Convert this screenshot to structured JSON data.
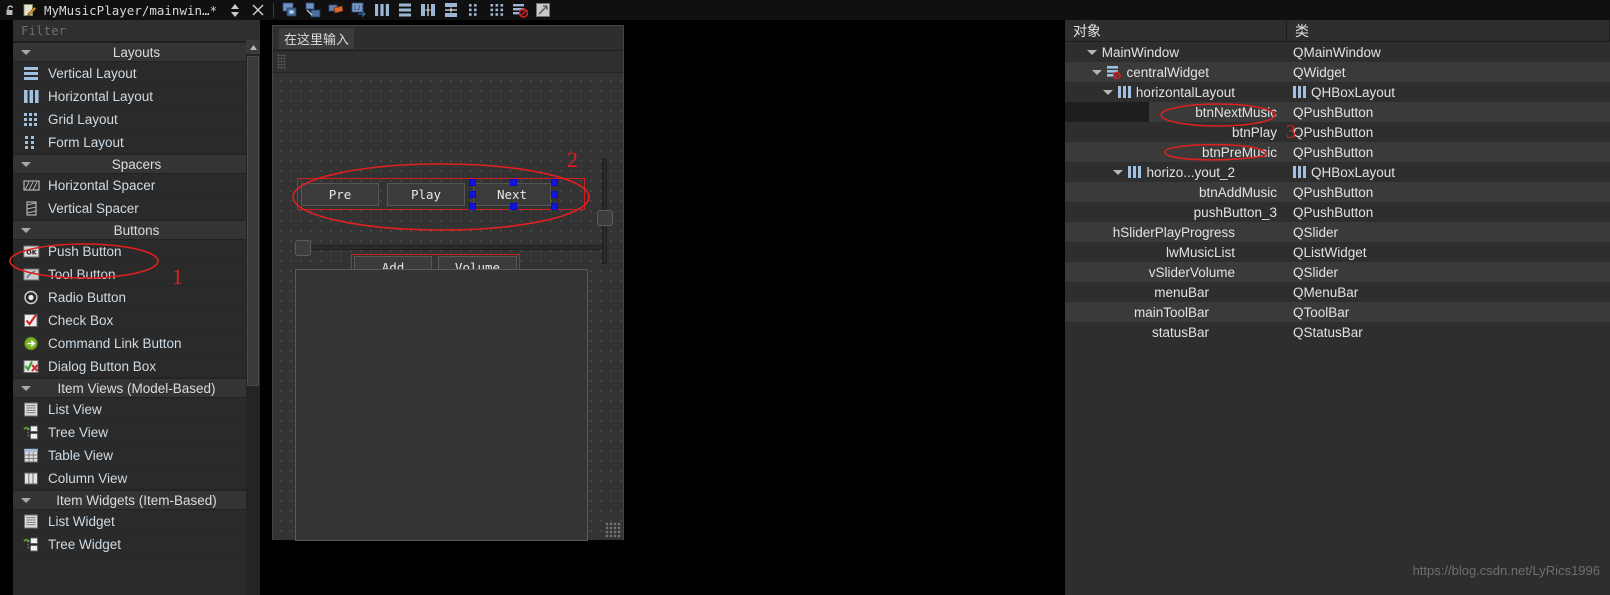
{
  "titlebar": {
    "title": "MyMusicPlayer/mainwin…*",
    "icons": [
      {
        "name": "lock-open-icon"
      },
      {
        "name": "edit-pencil-icon"
      }
    ],
    "buttons": [
      {
        "name": "spin-updown-button"
      },
      {
        "name": "close-button"
      },
      {
        "name": "edit-widgets-button"
      },
      {
        "name": "edit-signals-slots-button"
      },
      {
        "name": "edit-buddies-button"
      },
      {
        "name": "edit-tab-order-button"
      },
      {
        "name": "layout-horizontally-button"
      },
      {
        "name": "layout-vertically-button"
      },
      {
        "name": "layout-splitter-horizontal-button"
      },
      {
        "name": "layout-splitter-vertical-button"
      },
      {
        "name": "layout-form-button"
      },
      {
        "name": "layout-grid-button"
      },
      {
        "name": "break-layout-button"
      },
      {
        "name": "adjust-size-button"
      }
    ]
  },
  "widgetbox": {
    "filter_placeholder": "Filter",
    "groups": [
      {
        "label": "Layouts",
        "items": [
          {
            "label": "Vertical Layout",
            "icon": "vertical-layout-icon"
          },
          {
            "label": "Horizontal Layout",
            "icon": "horizontal-layout-icon"
          },
          {
            "label": "Grid Layout",
            "icon": "grid-layout-icon"
          },
          {
            "label": "Form Layout",
            "icon": "form-layout-icon"
          }
        ]
      },
      {
        "label": "Spacers",
        "items": [
          {
            "label": "Horizontal Spacer",
            "icon": "horizontal-spacer-icon"
          },
          {
            "label": "Vertical Spacer",
            "icon": "vertical-spacer-icon"
          }
        ]
      },
      {
        "label": "Buttons",
        "items": [
          {
            "label": "Push Button",
            "icon": "push-button-icon"
          },
          {
            "label": "Tool Button",
            "icon": "tool-button-icon"
          },
          {
            "label": "Radio Button",
            "icon": "radio-button-icon"
          },
          {
            "label": "Check Box",
            "icon": "check-box-icon"
          },
          {
            "label": "Command Link Button",
            "icon": "command-link-button-icon"
          },
          {
            "label": "Dialog Button Box",
            "icon": "dialog-button-box-icon"
          }
        ]
      },
      {
        "label": "Item Views (Model-Based)",
        "items": [
          {
            "label": "List View",
            "icon": "list-view-icon"
          },
          {
            "label": "Tree View",
            "icon": "tree-view-icon"
          },
          {
            "label": "Table View",
            "icon": "table-view-icon"
          },
          {
            "label": "Column View",
            "icon": "column-view-icon"
          }
        ]
      },
      {
        "label": "Item Widgets (Item-Based)",
        "items": [
          {
            "label": "List Widget",
            "icon": "list-widget-icon"
          },
          {
            "label": "Tree Widget",
            "icon": "tree-widget-icon"
          }
        ]
      }
    ]
  },
  "form": {
    "menu_entry": "在这里输入",
    "buttons_row1": [
      "Pre",
      "Play",
      "Next"
    ],
    "buttons_row2": [
      "Add",
      "Volume"
    ]
  },
  "inspector": {
    "headers": {
      "object": "对象",
      "class": "类"
    },
    "rows": [
      {
        "name": "MainWindow",
        "class": "QMainWindow",
        "indent": 0,
        "expander": true,
        "icon": "",
        "class_icon": ""
      },
      {
        "name": "centralWidget",
        "class": "QWidget",
        "indent": 1,
        "expander": true,
        "icon": "central-widget-icon",
        "class_icon": ""
      },
      {
        "name": "horizontalLayout",
        "class": "QHBoxLayout",
        "indent": 2,
        "expander": true,
        "icon": "hbox-layout-icon",
        "class_icon": "hbox-layout-icon"
      },
      {
        "name": "btnNextMusic",
        "class": "QPushButton",
        "indent": 3,
        "expander": false,
        "icon": "",
        "class_icon": ""
      },
      {
        "name": "btnPlay",
        "class": "QPushButton",
        "indent": 3,
        "expander": false,
        "icon": "",
        "class_icon": ""
      },
      {
        "name": "btnPreMusic",
        "class": "QPushButton",
        "indent": 3,
        "expander": false,
        "icon": "",
        "class_icon": ""
      },
      {
        "name": "horizo...yout_2",
        "class": "QHBoxLayout",
        "indent": 2,
        "expander": true,
        "icon": "hbox-layout-icon",
        "class_icon": "hbox-layout-icon"
      },
      {
        "name": "btnAddMusic",
        "class": "QPushButton",
        "indent": 3,
        "expander": false,
        "icon": "",
        "class_icon": ""
      },
      {
        "name": "pushButton_3",
        "class": "QPushButton",
        "indent": 3,
        "expander": false,
        "icon": "",
        "class_icon": ""
      },
      {
        "name": "hSliderPlayProgress",
        "class": "QSlider",
        "indent": 2,
        "expander": false,
        "icon": "",
        "class_icon": ""
      },
      {
        "name": "lwMusicList",
        "class": "QListWidget",
        "indent": 2,
        "expander": false,
        "icon": "",
        "class_icon": ""
      },
      {
        "name": "vSliderVolume",
        "class": "QSlider",
        "indent": 2,
        "expander": false,
        "icon": "",
        "class_icon": ""
      },
      {
        "name": "menuBar",
        "class": "QMenuBar",
        "indent": 1,
        "expander": false,
        "icon": "",
        "class_icon": ""
      },
      {
        "name": "mainToolBar",
        "class": "QToolBar",
        "indent": 1,
        "expander": false,
        "icon": "",
        "class_icon": ""
      },
      {
        "name": "statusBar",
        "class": "QStatusBar",
        "indent": 1,
        "expander": false,
        "icon": "",
        "class_icon": ""
      }
    ]
  },
  "annotations": {
    "one": "1",
    "two": "2",
    "three": "3",
    "color": "#e02020"
  },
  "watermark": "https://blog.csdn.net/LyRics1996"
}
